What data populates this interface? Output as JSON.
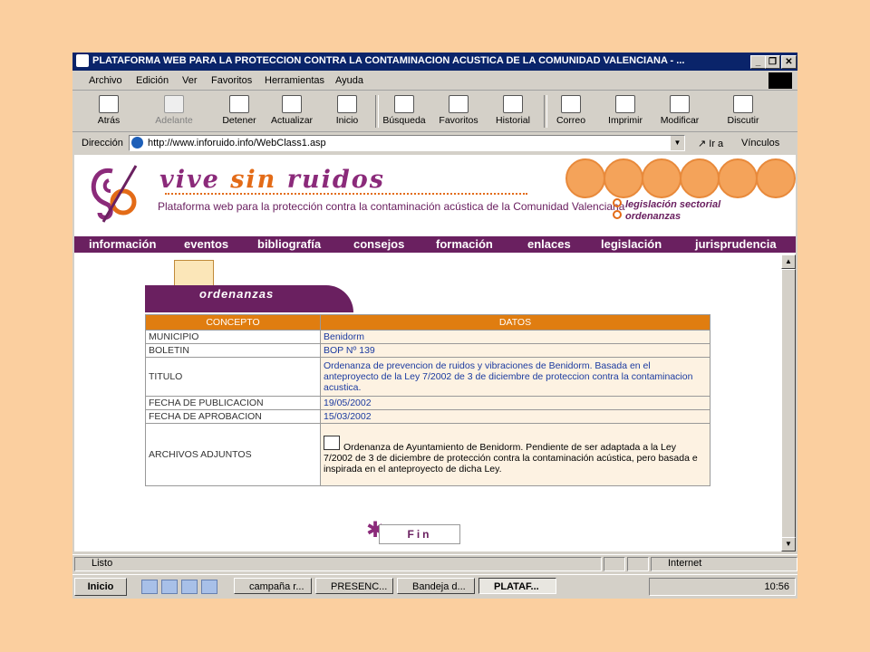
{
  "window": {
    "title": "PLATAFORMA WEB PARA LA PROTECCION CONTRA LA CONTAMINACION ACUSTICA DE LA COMUNIDAD VALENCIANA - ..."
  },
  "menu": [
    "Archivo",
    "Edición",
    "Ver",
    "Favoritos",
    "Herramientas",
    "Ayuda"
  ],
  "toolbar": [
    {
      "label": "Atrás",
      "icon": "back-icon"
    },
    {
      "label": "Adelante",
      "icon": "forward-icon"
    },
    {
      "label": "Detener",
      "icon": "stop-icon"
    },
    {
      "label": "Actualizar",
      "icon": "refresh-icon"
    },
    {
      "label": "Inicio",
      "icon": "home-icon"
    },
    {
      "label": "Búsqueda",
      "icon": "search-icon"
    },
    {
      "label": "Favoritos",
      "icon": "favorites-icon"
    },
    {
      "label": "Historial",
      "icon": "history-icon"
    },
    {
      "label": "Correo",
      "icon": "mail-icon"
    },
    {
      "label": "Imprimir",
      "icon": "print-icon"
    },
    {
      "label": "Modificar",
      "icon": "edit-icon"
    },
    {
      "label": "Discutir",
      "icon": "discuss-icon"
    }
  ],
  "address": {
    "label": "Dirección",
    "url": "http://www.inforuido.info/WebClass1.asp",
    "go": "Ir a",
    "links": "Vínculos"
  },
  "site": {
    "brand_vive": "vive",
    "brand_sin": "sin",
    "brand_ruidos": "ruidos",
    "tagline": "Plataforma web para la protección contra la contaminación acústica de la Comunidad Valenciana",
    "legislacion": "legislación sectorial",
    "ordenanzas_link": "ordenanzas",
    "nav": [
      "información",
      "eventos",
      "bibliografía",
      "consejos",
      "formación",
      "enlaces",
      "legislación",
      "jurisprudencia"
    ],
    "section_title": "ordenanzas"
  },
  "table": {
    "col_concepto": "CONCEPTO",
    "col_datos": "DATOS",
    "rows": [
      {
        "k": "MUNICIPIO",
        "v": "Benidorm"
      },
      {
        "k": "BOLETIN",
        "v": "BOP Nº 139"
      },
      {
        "k": "TITULO",
        "v": "Ordenanza de prevencion de ruidos y vibraciones de Benidorm. Basada en el anteproyecto de la Ley 7/2002 de 3 de diciembre de proteccion contra la contaminacion acustica."
      },
      {
        "k": "FECHA DE PUBLICACION",
        "v": "19/05/2002"
      },
      {
        "k": "FECHA DE APROBACION",
        "v": "15/03/2002"
      },
      {
        "k": "ARCHIVOS ADJUNTOS",
        "v": "Ordenanza de Ayuntamiento de Benidorm. Pendiente de ser adaptada a la Ley 7/2002 de 3 de diciembre de protección contra la contaminación acústica, pero basada e inspirada en el anteproyecto de dicha Ley."
      }
    ]
  },
  "fin": "Fin",
  "status": {
    "text": "Listo",
    "zone": "Internet"
  },
  "taskbar": {
    "start": "Inicio",
    "tasks": [
      "campaña r...",
      "PRESENC...",
      "Bandeja d...",
      "PLATAF..."
    ],
    "clock": "10:56"
  }
}
